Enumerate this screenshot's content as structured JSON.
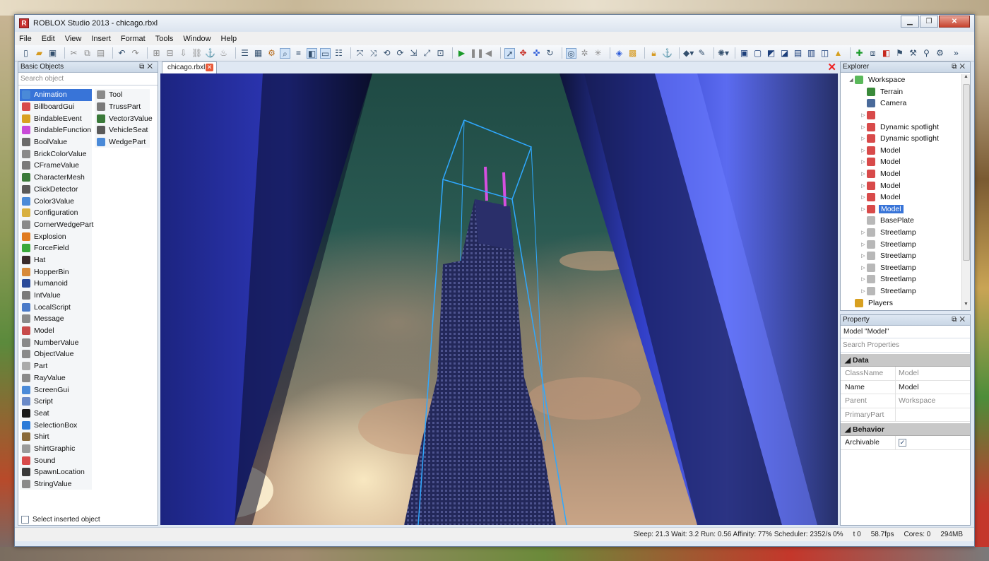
{
  "window": {
    "title": "ROBLOX Studio 2013 - chicago.rbxl",
    "logo_letter": "R"
  },
  "menu": [
    "File",
    "Edit",
    "View",
    "Insert",
    "Format",
    "Tools",
    "Window",
    "Help"
  ],
  "basic_objects": {
    "title": "Basic Objects",
    "search_placeholder": "Search object",
    "column1": [
      "Animation",
      "BillboardGui",
      "BindableEvent",
      "BindableFunction",
      "BoolValue",
      "BrickColorValue",
      "CFrameValue",
      "CharacterMesh",
      "ClickDetector",
      "Color3Value",
      "Configuration",
      "CornerWedgePart",
      "Explosion",
      "ForceField",
      "Hat",
      "HopperBin",
      "Humanoid",
      "IntValue",
      "LocalScript",
      "Message",
      "Model",
      "NumberValue",
      "ObjectValue",
      "Part",
      "RayValue",
      "ScreenGui",
      "Script",
      "Seat",
      "SelectionBox",
      "Shirt",
      "ShirtGraphic",
      "Sound",
      "SpawnLocation",
      "StringValue"
    ],
    "column2": [
      "Tool",
      "TrussPart",
      "Vector3Value",
      "VehicleSeat",
      "WedgePart"
    ],
    "selected": "Animation",
    "footer_label": "Select inserted object"
  },
  "tab": {
    "label": "chicago.rbxl"
  },
  "explorer": {
    "title": "Explorer",
    "items": [
      {
        "label": "Workspace",
        "depth": 0,
        "expander": "expanded",
        "icon": "workspace-icon"
      },
      {
        "label": "Terrain",
        "depth": 1,
        "expander": "none",
        "icon": "terrain-icon"
      },
      {
        "label": "Camera",
        "depth": 1,
        "expander": "none",
        "icon": "camera-icon"
      },
      {
        "label": "",
        "depth": 1,
        "expander": "collapsed",
        "icon": "model-icon"
      },
      {
        "label": "Dynamic spotlight",
        "depth": 1,
        "expander": "collapsed",
        "icon": "model-icon"
      },
      {
        "label": "Dynamic spotlight",
        "depth": 1,
        "expander": "collapsed",
        "icon": "model-icon"
      },
      {
        "label": "Model",
        "depth": 1,
        "expander": "collapsed",
        "icon": "model-icon"
      },
      {
        "label": "Model",
        "depth": 1,
        "expander": "collapsed",
        "icon": "model-icon"
      },
      {
        "label": "Model",
        "depth": 1,
        "expander": "collapsed",
        "icon": "model-icon"
      },
      {
        "label": "Model",
        "depth": 1,
        "expander": "collapsed",
        "icon": "model-icon"
      },
      {
        "label": "Model",
        "depth": 1,
        "expander": "collapsed",
        "icon": "model-icon"
      },
      {
        "label": "Model",
        "depth": 1,
        "expander": "collapsed",
        "icon": "model-icon",
        "selected": true
      },
      {
        "label": "BasePlate",
        "depth": 1,
        "expander": "none",
        "icon": "part-icon"
      },
      {
        "label": "Streetlamp",
        "depth": 1,
        "expander": "collapsed",
        "icon": "part-icon"
      },
      {
        "label": "Streetlamp",
        "depth": 1,
        "expander": "collapsed",
        "icon": "part-icon"
      },
      {
        "label": "Streetlamp",
        "depth": 1,
        "expander": "collapsed",
        "icon": "part-icon"
      },
      {
        "label": "Streetlamp",
        "depth": 1,
        "expander": "collapsed",
        "icon": "part-icon"
      },
      {
        "label": "Streetlamp",
        "depth": 1,
        "expander": "collapsed",
        "icon": "part-icon"
      },
      {
        "label": "Streetlamp",
        "depth": 1,
        "expander": "collapsed",
        "icon": "part-icon"
      },
      {
        "label": "Players",
        "depth": 0,
        "expander": "none",
        "icon": "players-icon"
      }
    ]
  },
  "property": {
    "title": "Property",
    "object_label": "Model \"Model\"",
    "search_placeholder": "Search Properties",
    "sections": [
      {
        "name": "Data",
        "rows": [
          {
            "name": "ClassName",
            "value": "Model",
            "readonly": true
          },
          {
            "name": "Name",
            "value": "Model",
            "readonly": false
          },
          {
            "name": "Parent",
            "value": "Workspace",
            "readonly": true
          },
          {
            "name": "PrimaryPart",
            "value": "",
            "readonly": true
          }
        ]
      },
      {
        "name": "Behavior",
        "rows": [
          {
            "name": "Archivable",
            "value": "✓",
            "checkbox": true,
            "readonly": false
          }
        ]
      }
    ]
  },
  "status": {
    "sleep": "Sleep: 21.3 Wait: 3.2 Run: 0.56 Affinity: 77% Scheduler: 2352/s 0%",
    "t": "t 0",
    "fps": "58.7fps",
    "cores": "Cores: 0",
    "memory": "294MB"
  },
  "colors": {
    "selection": "#3874d8",
    "selection_box": "#2fa8ff",
    "antenna": "#d64fe0"
  }
}
